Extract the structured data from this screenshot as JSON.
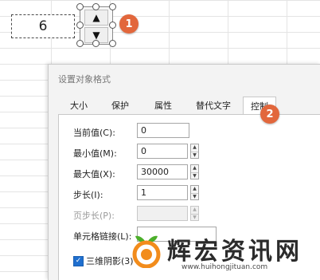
{
  "cell": {
    "value": "6"
  },
  "spinner": {
    "up_glyph": "▲",
    "down_glyph": "▼"
  },
  "badges": {
    "first": "1",
    "second": "2"
  },
  "dialog": {
    "title": "设置对象格式",
    "tabs": [
      "大小",
      "保护",
      "属性",
      "替代文字",
      "控制"
    ],
    "active_tab": "控制",
    "fields": {
      "current_value": {
        "label": "当前值(C):",
        "value": "0"
      },
      "min_value": {
        "label": "最小值(M):",
        "value": "0"
      },
      "max_value": {
        "label": "最大值(X):",
        "value": "30000"
      },
      "step": {
        "label": "步长(I):",
        "value": "1"
      },
      "page_step": {
        "label": "页步长(P):",
        "value": ""
      },
      "cell_link": {
        "label": "单元格链接(L):",
        "value": ""
      },
      "shading_3d": {
        "label": "三维阴影(3)",
        "checked": true
      }
    }
  },
  "watermark": {
    "text": "辉宏资讯网",
    "url": "www.huihongjituan.com"
  },
  "colors": {
    "badge": "#e2673c",
    "checkbox": "#1f6fcf",
    "logo_orange": "#f28c1c",
    "logo_green": "#4caf2a"
  }
}
